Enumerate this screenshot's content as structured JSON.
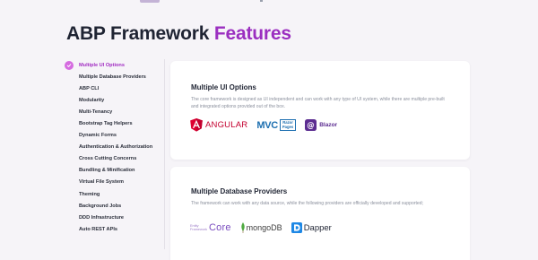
{
  "page": {
    "title_main": "ABP Framework ",
    "title_accent": "Features"
  },
  "sidebar": {
    "items": [
      {
        "label": "Multiple UI Options",
        "active": true
      },
      {
        "label": "Multiple Database Providers"
      },
      {
        "label": "ABP CLI"
      },
      {
        "label": "Modularity"
      },
      {
        "label": "Multi-Tenancy"
      },
      {
        "label": "Bootstrap Tag Helpers"
      },
      {
        "label": "Dynamic Forms"
      },
      {
        "label": "Authentication & Authorization"
      },
      {
        "label": "Cross Cutting Concerns"
      },
      {
        "label": "Bundling & Minification"
      },
      {
        "label": "Virtual File System"
      },
      {
        "label": "Theming"
      },
      {
        "label": "Background Jobs"
      },
      {
        "label": "DDD Infrastructure"
      },
      {
        "label": "Auto REST APIs"
      }
    ]
  },
  "cards": [
    {
      "title": "Multiple UI Options",
      "description": "The core framework is designed as UI independent and can work with any type of UI system, while there are multiple pre-built and integrated options provided out of the box.",
      "logos": {
        "angular": "ANGULAR",
        "mvc": "MVC",
        "razor_line1": "Razor",
        "razor_line2": "Pages",
        "blazor": "Blazor"
      }
    },
    {
      "title": "Multiple Database Providers",
      "description": "The framework can work with any data source, while the following providers are officially developed and supported;",
      "logos": {
        "ef_line1": "Entity",
        "ef_line2": "Framework",
        "ef_core": "Core",
        "mongo": "mongoDB",
        "dapper": "Dapper"
      }
    }
  ],
  "colors": {
    "accent": "#9b2fc0",
    "check_bg": "#d56be0",
    "background": "#f6f4f8",
    "angular": "#c3002f",
    "mvc": "#1d6fb0",
    "blazor": "#5c2d91"
  },
  "icons": {
    "active_check": "check-circle-icon",
    "angular": "angular-logo-icon",
    "blazor": "blazor-logo-icon",
    "ef_core": "entity-framework-core-logo",
    "mongo": "mongodb-leaf-icon",
    "dapper": "dapper-logo-icon"
  }
}
